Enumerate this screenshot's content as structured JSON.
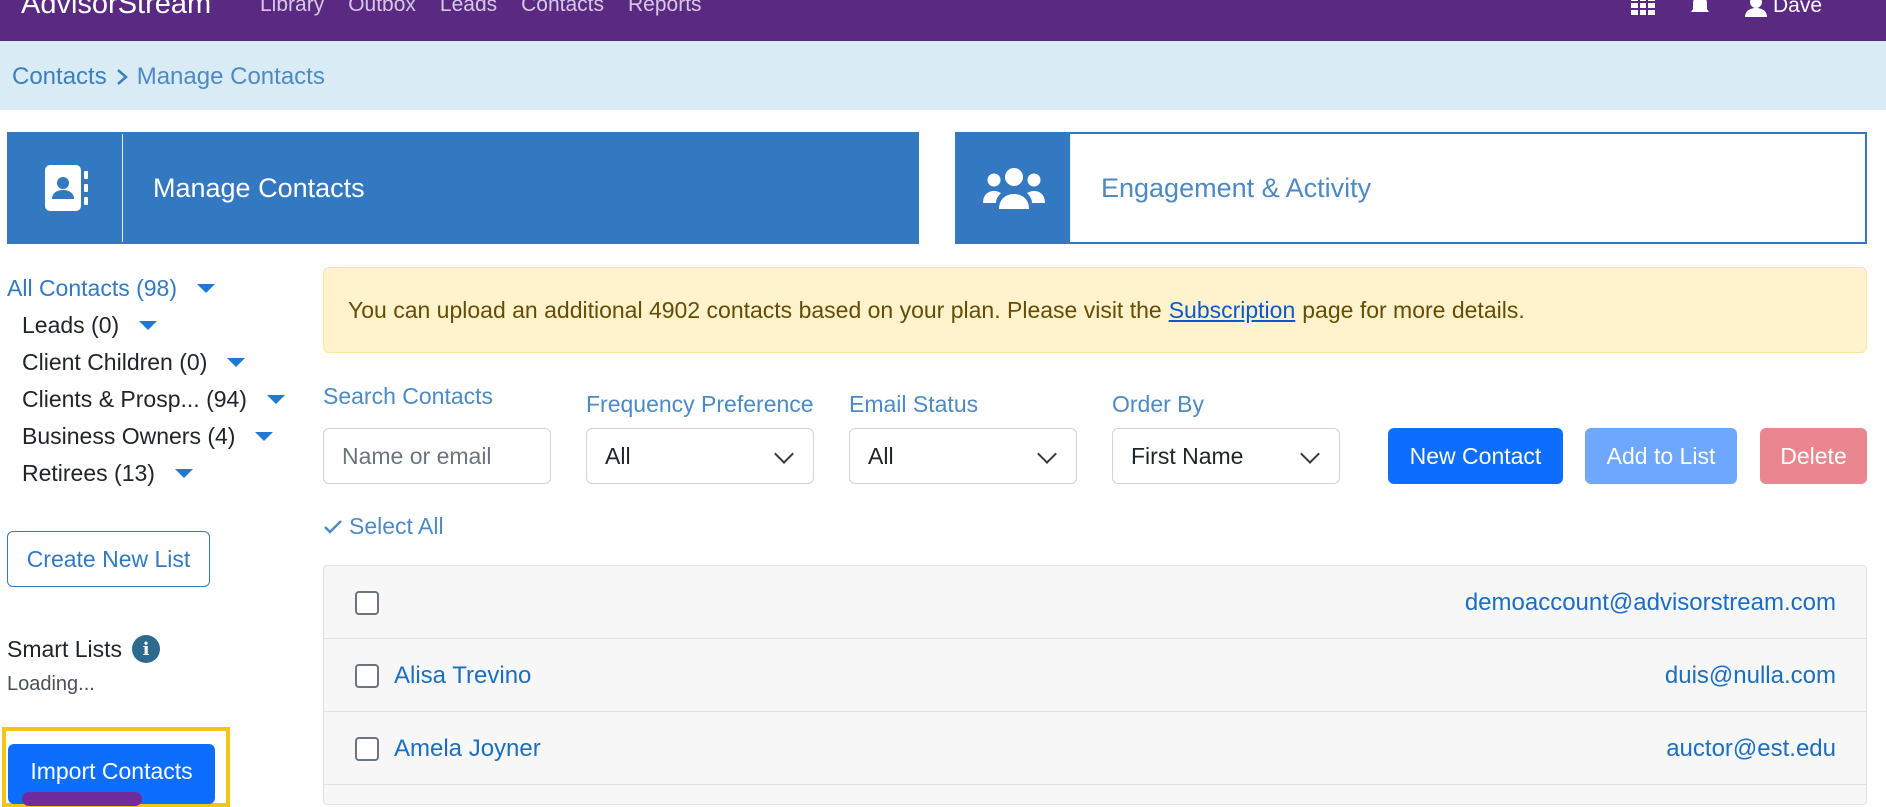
{
  "topbar": {
    "brand": "AdvisorStream",
    "nav": [
      "Library",
      "Outbox",
      "Leads",
      "Contacts",
      "Reports"
    ],
    "user": "Dave",
    "icons": [
      "grid-icon",
      "bell-icon",
      "user-icon"
    ]
  },
  "breadcrumb": {
    "parent": "Contacts",
    "current": "Manage Contacts"
  },
  "cards": [
    {
      "label": "Manage Contacts",
      "icon": "address-book-icon"
    },
    {
      "label": "Engagement & Activity",
      "icon": "users-icon"
    }
  ],
  "sidebar": {
    "lists": [
      {
        "label": "All Contacts (98)"
      },
      {
        "label": "Leads (0)"
      },
      {
        "label": "Client Children (0)"
      },
      {
        "label": "Clients & Prosp...  (94)"
      },
      {
        "label": "Business Owners (4)"
      },
      {
        "label": "Retirees (13)"
      }
    ],
    "create_list": "Create New List",
    "smart_lists": "Smart Lists",
    "loading": "Loading...",
    "import": "Import Contacts"
  },
  "alert": {
    "before": "You can upload an additional 4902 contacts based on your plan. Please visit the",
    "link": "Subscription",
    "after": "page for more details."
  },
  "filters": {
    "search_label": "Search Contacts",
    "search_placeholder": "Name or email",
    "frequency_label": "Frequency Preference",
    "frequency_value": "All",
    "email_status_label": "Email Status",
    "email_status_value": "All",
    "order_label": "Order By",
    "order_value": "First Name"
  },
  "actions": {
    "new": "New Contact",
    "add": "Add to List",
    "delete": "Delete"
  },
  "select_all": "Select All",
  "contacts": [
    {
      "name": "",
      "email": "demoaccount@advisorstream.com"
    },
    {
      "name": "Alisa Trevino",
      "email": "duis@nulla.com"
    },
    {
      "name": "Amela Joyner",
      "email": "auctor@est.edu"
    }
  ],
  "colors": {
    "topbar": "#5a2a82",
    "primary": "#3279c2",
    "alert_bg": "#fff3cd",
    "highlight": "#f3c515"
  }
}
